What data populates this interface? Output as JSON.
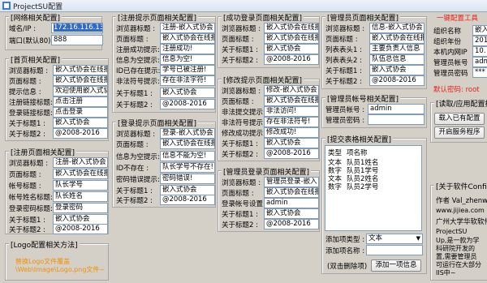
{
  "window": {
    "title": "ProjectSU配置"
  },
  "net": {
    "title": "[网络相关配置]",
    "domain_label": "域名/IP :",
    "domain_value": "172.16.116.132",
    "port_label": "端口(默认80):",
    "port_value": "888"
  },
  "home": {
    "title": "[首页相关配置]",
    "rows": [
      {
        "label": "浏览器标题 :",
        "value": "嵌入式协会在线报"
      },
      {
        "label": "页面标题 :",
        "value": "嵌入式协会在线报"
      },
      {
        "label": "提示信息 :",
        "value": "欢迎使用嵌入式协"
      },
      {
        "label": "注册链接标题:",
        "value": "点击注册"
      },
      {
        "label": "登录链接标题:",
        "value": "点击登录"
      },
      {
        "label": "关于标题1 :",
        "value": "嵌入式协会"
      },
      {
        "label": "关于标题2 :",
        "value": "@2008-2016"
      }
    ]
  },
  "register": {
    "title": "[注册页面相关配置]",
    "rows": [
      {
        "label": "浏览器标题 :",
        "value": "注册-嵌入式协会"
      },
      {
        "label": "页面标题 :",
        "value": "嵌入式协会在线报"
      },
      {
        "label": "帐号标题 :",
        "value": "队长学号"
      },
      {
        "label": "帐号姓名标题:",
        "value": "队长姓名"
      },
      {
        "label": "登录密码标题:",
        "value": "登录密码"
      },
      {
        "label": "关于标题1 :",
        "value": "嵌入式协会"
      },
      {
        "label": "关于标题2 :",
        "value": "@2008-2016"
      }
    ]
  },
  "log": {
    "title": "[Logo配置相关方法]",
    "hint1": "替换Logo文件覆盖",
    "hint2": "\\Web\\Image\\Logo.png文件~"
  },
  "reg_tip": {
    "title": "[注册提示页面相关配置]",
    "rows": [
      {
        "label": "浏览器标题 :",
        "value": "注册-嵌入式协会"
      },
      {
        "label": "页面标题 :",
        "value": "嵌入式协会在线报"
      },
      {
        "label": "注册成功提示:",
        "value": "注册成功!"
      },
      {
        "label": "信息为空提示:",
        "value": "信息为空!"
      },
      {
        "label": "ID已存在提示:",
        "value": "学号已被注册!"
      },
      {
        "label": "非法符号提示:",
        "value": "存在非法字符!"
      },
      {
        "label": "关于标题1 :",
        "value": "嵌入式协会"
      },
      {
        "label": "关于标题2 :",
        "value": "@2008-2016"
      }
    ]
  },
  "login_tip": {
    "title": "[登录提示页面相关配置]",
    "rows": [
      {
        "label": "浏览器标题 :",
        "value": "登录-嵌入式协会"
      },
      {
        "label": "页面标题 :",
        "value": "嵌入式协会在线报"
      },
      {
        "label": "信息为空提示:",
        "value": "信息不能为空!"
      },
      {
        "label": "ID不存在 :",
        "value": "队长学号不存在!"
      },
      {
        "label": "密码错误提示:",
        "value": "密码错误!"
      },
      {
        "label": "关于标题1 :",
        "value": "嵌入式协会"
      },
      {
        "label": "关于标题2 :",
        "value": "@2008-2016"
      }
    ]
  },
  "success": {
    "title": "[成功登录页面相关配置]",
    "rows": [
      {
        "label": "浏览器标题 :",
        "value": "嵌入式协会在线报"
      },
      {
        "label": "页面标题 :",
        "value": "嵌入式协会在线报"
      },
      {
        "label": "关于标题1 :",
        "value": "嵌入式协会"
      },
      {
        "label": "关于标题2 :",
        "value": "@2008-2016"
      }
    ]
  },
  "modify": {
    "title": "[修改提示页面相关配置]",
    "rows": [
      {
        "label": "浏览器标题 :",
        "value": "修改-嵌入式协会"
      },
      {
        "label": "页面标题 :",
        "value": "嵌入式协会在线报"
      },
      {
        "label": "非法提交提示:",
        "value": "非法访问!"
      },
      {
        "label": "非法符号提示:",
        "value": "存在非法符号!"
      },
      {
        "label": "修改成功提示:",
        "value": "修改成功!"
      },
      {
        "label": "关于标题1 :",
        "value": "嵌入式协会"
      },
      {
        "label": "关于标题2 :",
        "value": "@2008-2016"
      }
    ]
  },
  "admin_login": {
    "title": "[管理员登录页面相关配置]",
    "rows": [
      {
        "label": "浏览器标题 :",
        "value": "管理员登录-嵌入"
      },
      {
        "label": "页面标题 :",
        "value": "嵌入式协会在线报"
      },
      {
        "label": "登录帐号设置:",
        "value": "admin"
      },
      {
        "label": "关于标题1 :",
        "value": "嵌入式协会"
      },
      {
        "label": "关于标题2 :",
        "value": "@2008-2016"
      }
    ]
  },
  "admin_page": {
    "title": "[管理员页面相关配置]",
    "rows": [
      {
        "label": "浏览器标题 :",
        "value": "信息-嵌入式协会"
      },
      {
        "label": "页面标题 :",
        "value": "嵌入式协会在线报"
      },
      {
        "label": "列表表头1 :",
        "value": "主要负责人信息"
      },
      {
        "label": "列表表头2 :",
        "value": "队伍总信息"
      },
      {
        "label": "关于标题1 :",
        "value": "嵌入式协会"
      },
      {
        "label": "关于标题2 :",
        "value": "@2008-2016"
      }
    ]
  },
  "admin_acct": {
    "title": "[管理员帐号相关配置]",
    "account_label": "管理员帐号 :",
    "account_value": "admin",
    "pwd_label": "管理员密码 :",
    "pwd_value": ""
  },
  "submit_table": {
    "title": "[提交表格相关配置]",
    "col_type": "类型",
    "col_name": "项名称",
    "rows": [
      {
        "type": "文本",
        "name": "队员1姓名"
      },
      {
        "type": "数字",
        "name": "队员1学号"
      },
      {
        "type": "文本",
        "name": "队员2姓名"
      },
      {
        "type": "数字",
        "name": "队员2学号"
      }
    ],
    "add_type_label": "添加项类型 :",
    "add_type_value": "文本",
    "add_name_label": "添加项名称 :",
    "add_name_value": "",
    "delete_hint": "(双击删除项)",
    "add_button": "添加一项信息"
  },
  "oneclick": {
    "title": "一键配置工具",
    "rows": [
      {
        "label": "组织名称",
        "value": "嵌入"
      },
      {
        "label": "组织年份",
        "value": "2016"
      },
      {
        "label": "本机内网IP",
        "value": "10."
      },
      {
        "label": "管理员帐号",
        "value": "adm"
      },
      {
        "label": "管理员密码",
        "value": "***"
      }
    ],
    "default_pwd": "默认密码: root"
  },
  "read_apply": {
    "title": "[读取/应用配置操作",
    "load_btn": "载入已有配置",
    "start_btn": "开启服务程序"
  },
  "about": {
    "title": "[关于软件Config2016",
    "author": "作者 Val_zhenwen",
    "site": "www.jijiea.com",
    "school": "广州大学华软软件",
    "line1": "ProjectSU",
    "line2": "Up,是一款为学",
    "line3": "科研院开发的",
    "line4": "置,需要管理员",
    "line5": "可运行在大部分",
    "line6": "IIS中~"
  }
}
